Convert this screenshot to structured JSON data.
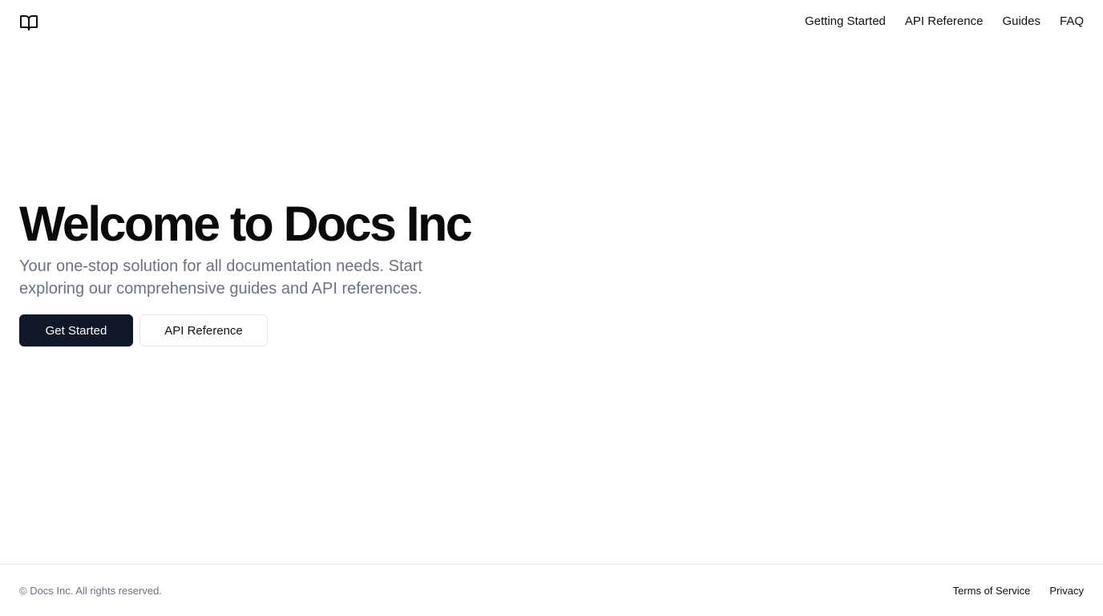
{
  "header": {
    "logo_icon": "book-open-icon",
    "nav": [
      {
        "label": "Getting Started"
      },
      {
        "label": "API Reference"
      },
      {
        "label": "Guides"
      },
      {
        "label": "FAQ"
      }
    ]
  },
  "hero": {
    "title": "Welcome to Docs Inc",
    "subtitle": "Your one-stop solution for all documentation needs. Start exploring our comprehensive guides and API references.",
    "primary_button": "Get Started",
    "secondary_button": "API Reference"
  },
  "footer": {
    "copyright": "© Docs Inc. All rights reserved.",
    "links": [
      {
        "label": "Terms of Service"
      },
      {
        "label": "Privacy"
      }
    ]
  },
  "colors": {
    "primary_button_bg": "#111827",
    "subtitle_text": "#6b7280",
    "border": "#e5e7eb"
  }
}
